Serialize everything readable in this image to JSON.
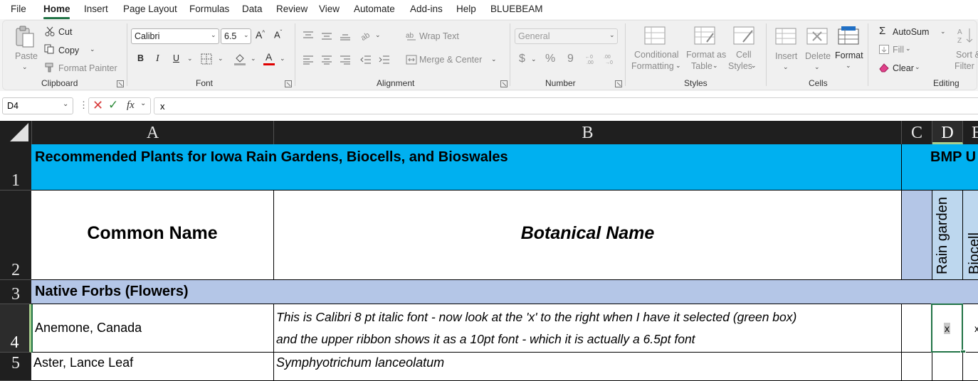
{
  "menu": {
    "file": "File",
    "home": "Home",
    "insert": "Insert",
    "page_layout": "Page Layout",
    "formulas": "Formulas",
    "data": "Data",
    "review": "Review",
    "view": "View",
    "automate": "Automate",
    "addins": "Add-ins",
    "help": "Help",
    "bluebeam": "BLUEBEAM"
  },
  "ribbon": {
    "clipboard": {
      "paste": "Paste",
      "cut": "Cut",
      "copy": "Copy",
      "format_painter": "Format Painter",
      "label": "Clipboard"
    },
    "font": {
      "name": "Calibri",
      "size": "6.5",
      "bold": "B",
      "italic": "I",
      "underline": "U",
      "font_color_glyph": "A",
      "label": "Font"
    },
    "alignment": {
      "wrap_text": "Wrap Text",
      "merge_center": "Merge & Center",
      "label": "Alignment"
    },
    "number": {
      "format": "General",
      "currency": "$",
      "percent": "%",
      "comma": "9",
      "label": "Number"
    },
    "styles": {
      "conditional_1": "Conditional",
      "conditional_2": "Formatting",
      "format_as_1": "Format as",
      "format_as_2": "Table",
      "cell_styles_1": "Cell",
      "cell_styles_2": "Styles",
      "label": "Styles"
    },
    "cells": {
      "insert": "Insert",
      "delete": "Delete",
      "format": "Format",
      "label": "Cells"
    },
    "editing": {
      "autosum": "AutoSum",
      "fill": "Fill",
      "clear": "Clear",
      "sort_1": "Sort &",
      "sort_2": "Filter",
      "label": "Editing"
    }
  },
  "formula_bar": {
    "name_box": "D4",
    "fx": "fx",
    "formula": "x"
  },
  "columns": [
    "A",
    "B",
    "C",
    "D",
    "E"
  ],
  "rows": [
    "1",
    "2",
    "3",
    "4",
    "5"
  ],
  "sheet": {
    "r1_title": "Recommended Plants for Iowa Rain Gardens, Biocells, and Bioswales",
    "r1_bmp": "BMP U",
    "r2_common": "Common Name",
    "r2_botanical": "Botanical Name",
    "r2_d": "Rain garden",
    "r2_e": "Biocell",
    "r3_section": "Native Forbs (Flowers)",
    "r4_common": "Anemone, Canada",
    "r4_botanical_line1": "This is Calibri 8 pt italic font - now look at the 'x' to the right when I have it selected (green box)",
    "r4_botanical_line2": "and the upper ribbon shows it as a 10pt font - which it is actually a 6.5pt font",
    "r4_d": "x",
    "r4_e": "x",
    "r5_common": "Aster, Lance Leaf",
    "r5_botanical": "Symphyotrichum lanceolatum"
  },
  "colors": {
    "title_fill": "#00b0f0",
    "header_fill": "#b4c6e7",
    "selection": "#217346",
    "accent_green": "#217346"
  }
}
